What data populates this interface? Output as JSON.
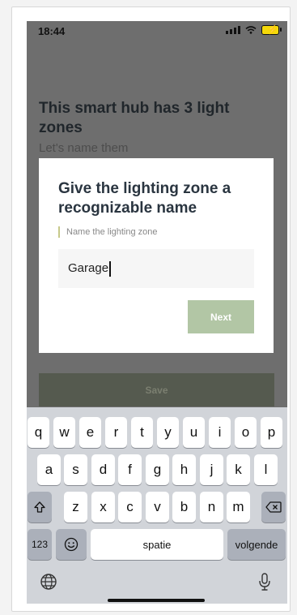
{
  "status": {
    "time": "18:44"
  },
  "background": {
    "title": "This smart hub has 3 light zones",
    "subtitle": "Let's name them",
    "save_label": "Save"
  },
  "modal": {
    "title": "Give the lighting zone a recognizable name",
    "input_label": "Name the lighting zone",
    "input_value": "Garage",
    "next_label": "Next"
  },
  "keyboard": {
    "row1": [
      "q",
      "w",
      "e",
      "r",
      "t",
      "y",
      "u",
      "i",
      "o",
      "p"
    ],
    "row2": [
      "a",
      "s",
      "d",
      "f",
      "g",
      "h",
      "j",
      "k",
      "l"
    ],
    "row3": [
      "z",
      "x",
      "c",
      "v",
      "b",
      "n",
      "m"
    ],
    "numbers_label": "123",
    "space_label": "spatie",
    "return_label": "volgende"
  },
  "colors": {
    "next_button": "#b2c6a5",
    "save_button": "#555a4f",
    "label_accent": "#c7c98a"
  },
  "icons": {
    "shift": "shift-icon",
    "backspace": "backspace-icon",
    "emoji": "emoji-icon",
    "globe": "globe-icon",
    "microphone": "microphone-icon"
  }
}
